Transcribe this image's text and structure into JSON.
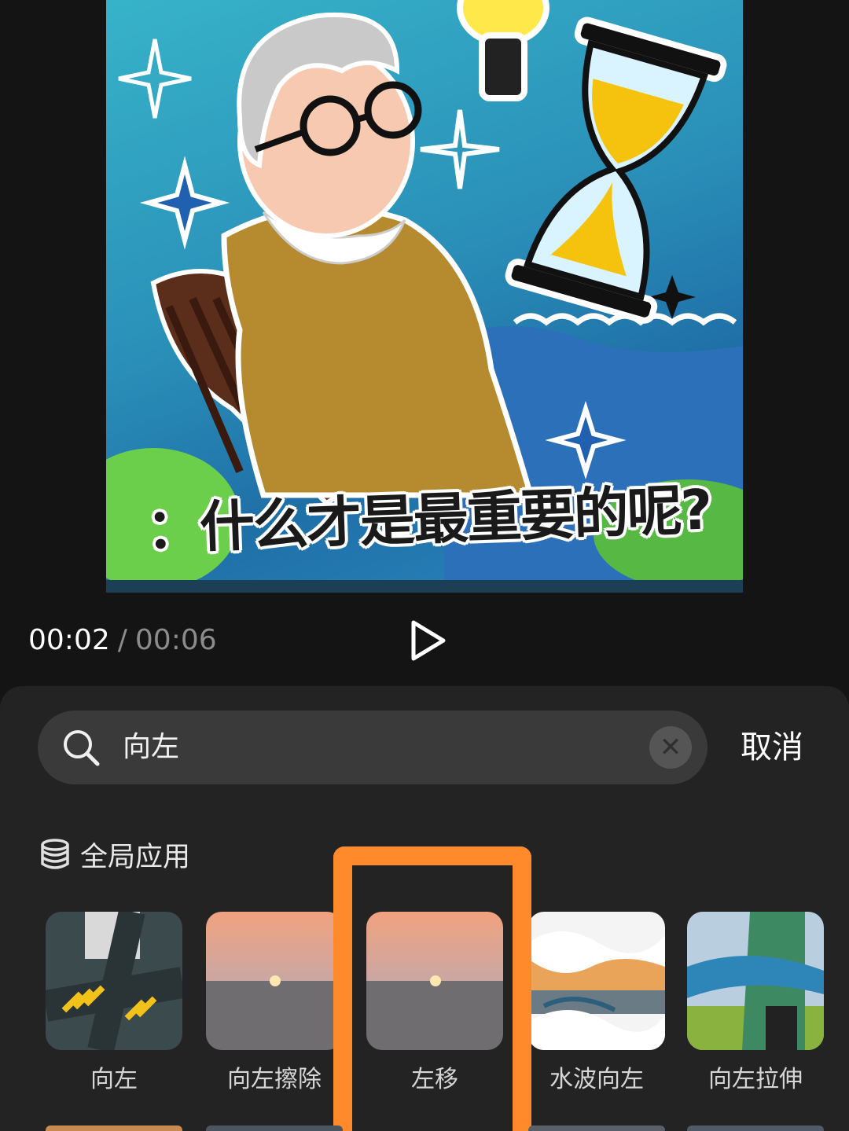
{
  "preview": {
    "caption": "：什么才是最重要的呢?",
    "image": "illustration-old-woman-hourglass"
  },
  "playback": {
    "current_time": "00:02",
    "separator": "/",
    "total_time": "00:06",
    "play_icon": "play-icon"
  },
  "search": {
    "icon": "search-icon",
    "value": "向左",
    "clear_icon": "clear-icon",
    "clear_glyph": "✕",
    "cancel_label": "取消"
  },
  "global_apply": {
    "icon": "stack-icon",
    "label": "全局应用"
  },
  "effects": [
    {
      "label": "向左",
      "thumbnail": "aerial-crosswalk"
    },
    {
      "label": "向左擦除",
      "thumbnail": "sunset-sea"
    },
    {
      "label": "左移",
      "thumbnail": "sunset-sea",
      "selected": true
    },
    {
      "label": "水波向左",
      "thumbnail": "water-splash-forest"
    },
    {
      "label": "向左拉伸",
      "thumbnail": "skateboarder"
    }
  ],
  "colors": {
    "highlight": "#ff8a2c",
    "sheet_background": "#232323",
    "search_background": "#3a3a3a"
  }
}
